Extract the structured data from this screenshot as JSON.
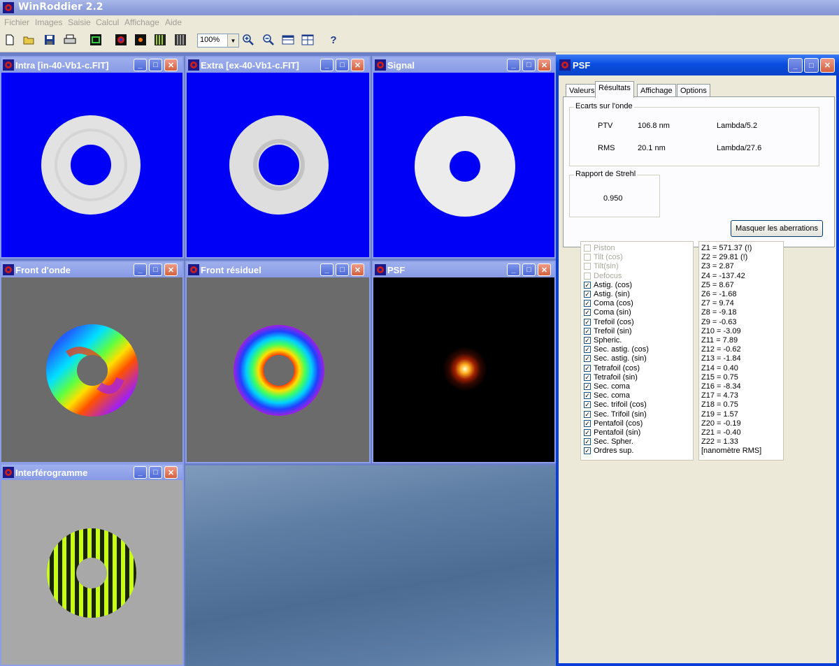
{
  "app": {
    "title": "WinRoddier 2.2"
  },
  "menu": [
    "Fichier",
    "Images",
    "Saisie",
    "Calcul",
    "Affichage",
    "Aide"
  ],
  "toolbar": {
    "icons": [
      "new-file-icon",
      "open-folder-icon",
      "save-icon",
      "print-icon",
      "green-frame-icon",
      "red-blue-icon",
      "black-dot-icon",
      "fringes-icon",
      "grid-icon"
    ],
    "zoom": "100%"
  },
  "windows": {
    "intra": {
      "title": "Intra [in-40-Vb1-c.FIT]"
    },
    "extra": {
      "title": "Extra [ex-40-Vb1-c.FIT]"
    },
    "signal": {
      "title": "Signal"
    },
    "front": {
      "title": "Front d'onde"
    },
    "residuel": {
      "title": "Front résiduel"
    },
    "psf_small": {
      "title": "PSF"
    },
    "interfero": {
      "title": "Interférogramme"
    }
  },
  "psf": {
    "title": "PSF",
    "tabs": [
      "Valeurs",
      "Résultats",
      "Affichage",
      "Options"
    ],
    "active_tab": "Résultats",
    "ecarts": {
      "label": "Ecarts sur l'onde",
      "ptv_label": "PTV",
      "ptv_value": "106.8 nm",
      "ptv_lambda": "Lambda/5.2",
      "rms_label": "RMS",
      "rms_value": "20.1 nm",
      "rms_lambda": "Lambda/27.6"
    },
    "strehl": {
      "label": "Rapport de Strehl",
      "value": "0.950"
    },
    "mask_button": "Masquer les aberrations",
    "aberrations": [
      {
        "name": "Piston",
        "checked": false,
        "enabled": false
      },
      {
        "name": "Tilt (cos)",
        "checked": false,
        "enabled": false
      },
      {
        "name": "Tilt(sin)",
        "checked": false,
        "enabled": false
      },
      {
        "name": "Defocus",
        "checked": false,
        "enabled": false
      },
      {
        "name": "Astig. (cos)",
        "checked": true,
        "enabled": true
      },
      {
        "name": "Astig. (sin)",
        "checked": true,
        "enabled": true
      },
      {
        "name": "Coma (cos)",
        "checked": true,
        "enabled": true
      },
      {
        "name": "Coma (sin)",
        "checked": true,
        "enabled": true
      },
      {
        "name": "Trefoil (cos)",
        "checked": true,
        "enabled": true
      },
      {
        "name": "Trefoil (sin)",
        "checked": true,
        "enabled": true
      },
      {
        "name": "Spheric.",
        "checked": true,
        "enabled": true
      },
      {
        "name": "Sec. astig. (cos)",
        "checked": true,
        "enabled": true
      },
      {
        "name": "Sec. astig. (sin)",
        "checked": true,
        "enabled": true
      },
      {
        "name": "Tetrafoil (cos)",
        "checked": true,
        "enabled": true
      },
      {
        "name": "Tetrafoil (sin)",
        "checked": true,
        "enabled": true
      },
      {
        "name": "Sec. coma",
        "checked": true,
        "enabled": true
      },
      {
        "name": "Sec. coma",
        "checked": true,
        "enabled": true
      },
      {
        "name": "Sec. trifoil (cos)",
        "checked": true,
        "enabled": true
      },
      {
        "name": "Sec. Trifoil (sin)",
        "checked": true,
        "enabled": true
      },
      {
        "name": "Pentafoil (cos)",
        "checked": true,
        "enabled": true
      },
      {
        "name": "Pentafoil (sin)",
        "checked": true,
        "enabled": true
      },
      {
        "name": "Sec. Spher.",
        "checked": true,
        "enabled": true
      },
      {
        "name": "Ordres sup.",
        "checked": true,
        "enabled": true
      }
    ],
    "zernike": [
      "Z1 = 571.37  (!)",
      "Z2 = 29.81  (!)",
      "Z3 = 2.87",
      "Z4 = -137.42",
      "Z5 = 8.67",
      "Z6 = -1.68",
      "Z7 = 9.74",
      "Z8 = -9.18",
      "Z9 = -0.63",
      "Z10 = -3.09",
      "Z11 = 7.89",
      "Z12 = -0.62",
      "Z13 = -1.84",
      "Z14 = 0.40",
      "Z15 = 0.75",
      "Z16 = -8.34",
      "Z17 = 4.73",
      "Z18 = 0.75",
      "Z19 = 1.57",
      "Z20 = -0.19",
      "Z21 = -0.40",
      "Z22 = 1.33",
      "[nanomètre RMS]"
    ]
  }
}
